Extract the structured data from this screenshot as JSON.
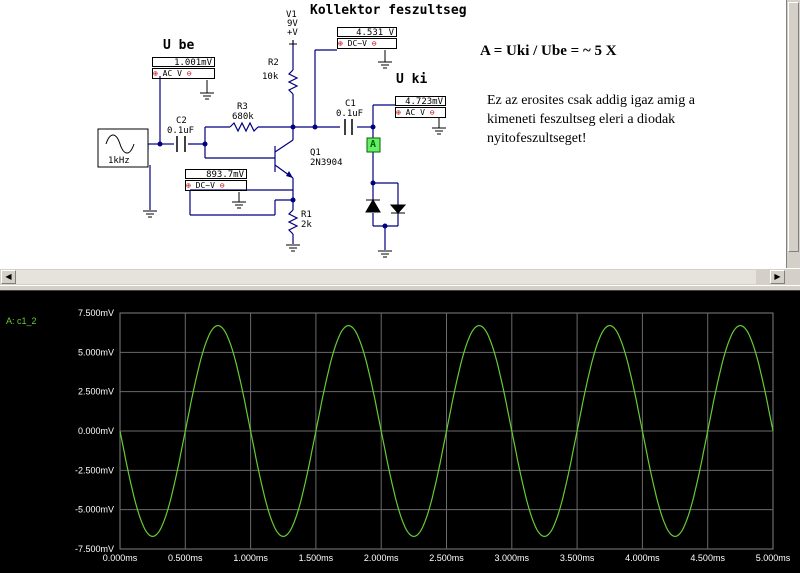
{
  "schematic": {
    "title": "Kollektor feszultseg",
    "u_be_label": "U be",
    "u_ki_label": "U ki",
    "v1": {
      "name": "V1",
      "value": "9V",
      "node": "+V"
    },
    "r2": {
      "name": "R2",
      "value": "10k"
    },
    "r3": {
      "name": "R3",
      "value": "680k"
    },
    "r1": {
      "name": "R1",
      "value": "2k"
    },
    "c2": {
      "name": "C2",
      "value": "0.1uF"
    },
    "c1": {
      "name": "C1",
      "value": "0.1uF"
    },
    "q1": {
      "name": "Q1",
      "value": "2N3904"
    },
    "generator": {
      "label": "1kHz"
    },
    "probe": {
      "label": "A"
    },
    "meters": {
      "input_ac": {
        "value": "1.001mV",
        "mode": "AC V"
      },
      "collector_dc": {
        "value": "4.531 V",
        "mode": "DC~V"
      },
      "output_ac": {
        "value": "4.723mV",
        "mode": "AC V"
      },
      "emitter_dc": {
        "value": "893.7mV",
        "mode": "DC~V"
      }
    },
    "formula": "A = Uki / Ube = ~ 5 X",
    "note_lines": [
      "Ez az erosites csak addig igaz amig a",
      "kimeneti feszultseg eleri a diodak",
      "nyitofeszultseget!"
    ]
  },
  "scrollbar": {
    "left_arrow": "◀",
    "right_arrow": "▶"
  },
  "chart_data": {
    "type": "line",
    "title": "",
    "xlabel": "",
    "ylabel": "",
    "xlim": [
      0,
      5
    ],
    "ylim": [
      -7.5,
      7.5
    ],
    "x_unit": "ms",
    "y_unit": "mV",
    "grid": true,
    "x_ticks": [
      "0.000ms",
      "0.500ms",
      "1.000ms",
      "1.500ms",
      "2.000ms",
      "2.500ms",
      "3.000ms",
      "3.500ms",
      "4.000ms",
      "4.500ms",
      "5.000ms"
    ],
    "y_ticks": [
      "7.500mV",
      "5.000mV",
      "2.500mV",
      "0.000mV",
      "-2.500mV",
      "-5.000mV",
      "-7.500mV"
    ],
    "series": [
      {
        "name": "A: c1_2",
        "color": "#66cc33",
        "frequency_khz": 1.0,
        "amplitude_mv": 6.7,
        "offset_mv": 0,
        "x_zero_cross_ms": 0.0,
        "polarity": "starts-negative"
      }
    ]
  }
}
